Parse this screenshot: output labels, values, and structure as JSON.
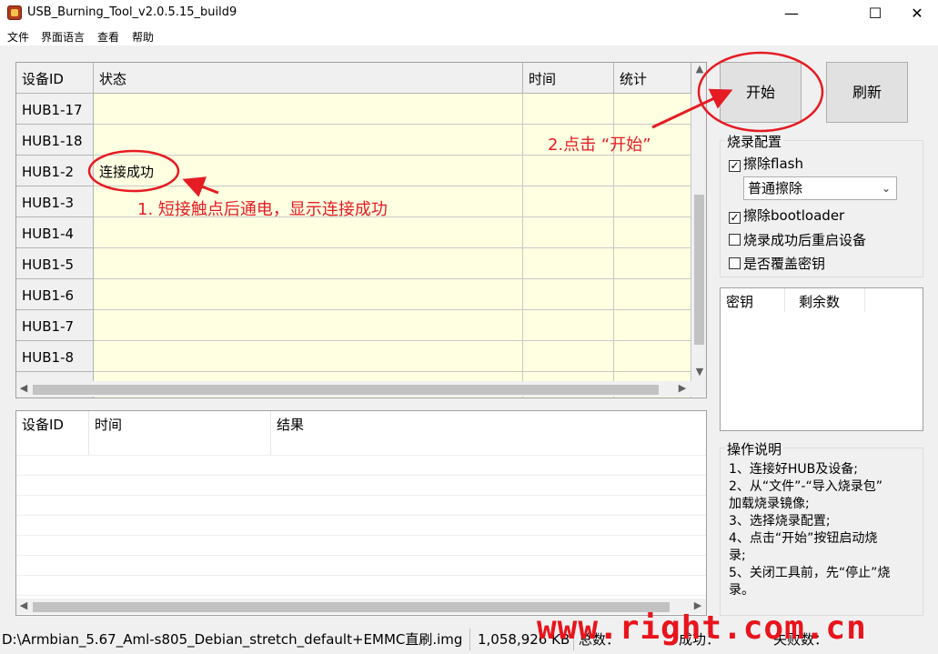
{
  "window": {
    "title": "USB_Burning_Tool_v2.0.5.15_build9",
    "minimize": "—",
    "maximize": "☐",
    "close": "✕"
  },
  "menu": {
    "items": [
      "文件",
      "界面语言",
      "查看",
      "帮助"
    ]
  },
  "device_table": {
    "headers": [
      "设备ID",
      "状态",
      "时间",
      "统计"
    ],
    "rows": [
      {
        "id": "HUB1-17",
        "status": ""
      },
      {
        "id": "HUB1-18",
        "status": ""
      },
      {
        "id": "HUB1-2",
        "status": "连接成功"
      },
      {
        "id": "HUB1-3",
        "status": ""
      },
      {
        "id": "HUB1-4",
        "status": ""
      },
      {
        "id": "HUB1-5",
        "status": ""
      },
      {
        "id": "HUB1-6",
        "status": ""
      },
      {
        "id": "HUB1-7",
        "status": ""
      },
      {
        "id": "HUB1-8",
        "status": ""
      }
    ]
  },
  "log_table": {
    "headers": [
      "设备ID",
      "时间",
      "结果"
    ]
  },
  "buttons": {
    "start": "开始",
    "refresh": "刷新"
  },
  "burn_config": {
    "title": "烧录配置",
    "erase_flash": {
      "label": "擦除flash",
      "checked": true
    },
    "erase_mode": "普通擦除",
    "erase_bootloader": {
      "label": "擦除bootloader",
      "checked": true
    },
    "reboot_after": {
      "label": "烧录成功后重启设备",
      "checked": false
    },
    "overwrite_key": {
      "label": "是否覆盖密钥",
      "checked": false
    }
  },
  "key_table": {
    "headers": [
      "密钥",
      "剩余数"
    ]
  },
  "instructions": {
    "title": "操作说明",
    "lines": [
      "1、连接好HUB及设备;",
      "2、从“文件”-“导入烧录包”",
      "加载烧录镜像;",
      "3、选择烧录配置;",
      "4、点击“开始”按钮启动烧",
      "录;",
      "5、关闭工具前，先“停止”烧",
      "录。"
    ]
  },
  "status_bar": {
    "file": "D:\\Armbian_5.67_Aml-s805_Debian_stretch_default+EMMC直刷.img",
    "size": "1,058,926 KB",
    "total_label": "总数：",
    "success_label": "成功：",
    "fail_label": "失败数："
  },
  "annotations": {
    "step1": "1. 短接触点后通电，显示连接成功",
    "step2": "2.点击 “开始”",
    "color": "#e51c23"
  },
  "watermark": "www.right.com.cn"
}
